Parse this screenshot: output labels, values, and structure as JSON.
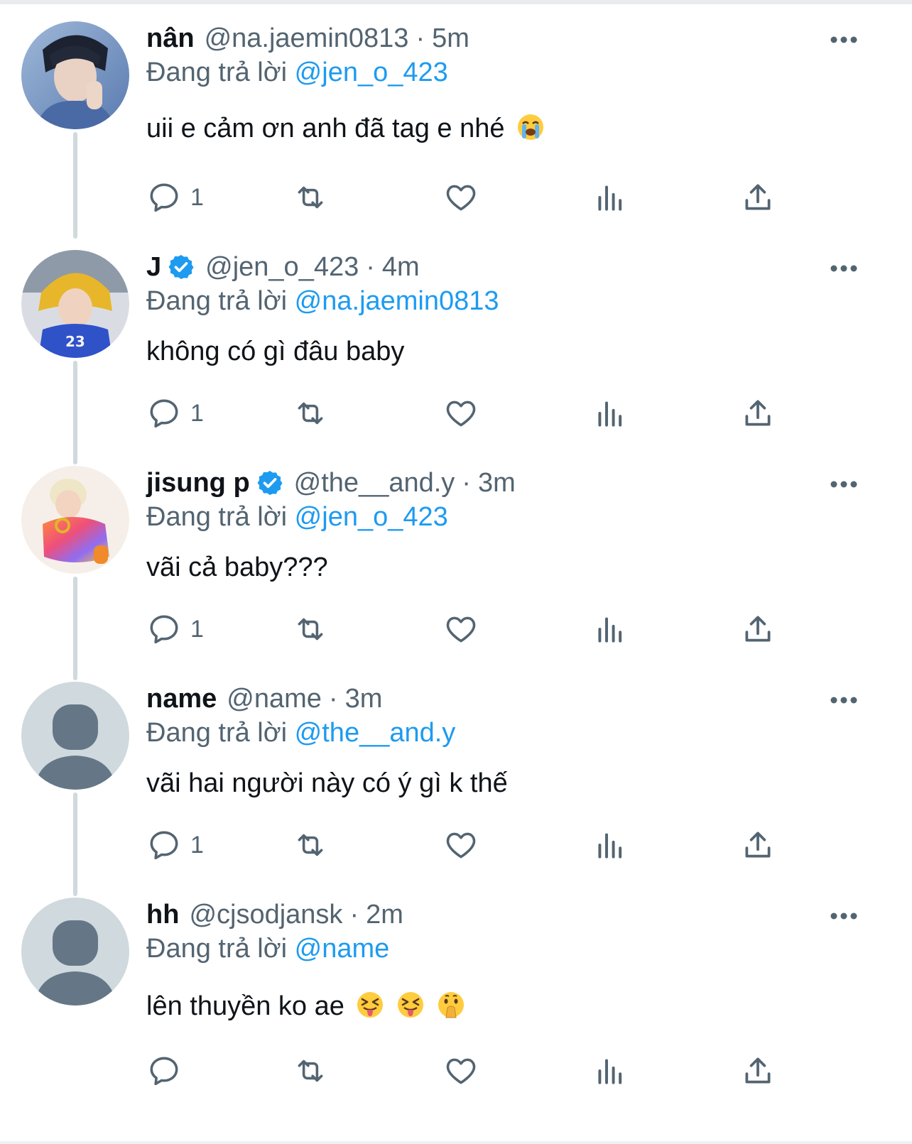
{
  "tweets": [
    {
      "display_name": "nân",
      "handle": "@na.jaemin0813",
      "time": "5m",
      "verified": false,
      "reply_prefix": "Đang trả lời",
      "reply_to": "@jen_o_423",
      "text": "uii e cảm ơn anh đã tag e nhé",
      "emojis": [
        "loudly-crying-face"
      ],
      "reply_count": "1"
    },
    {
      "display_name": "J",
      "handle": "@jen_o_423",
      "time": "4m",
      "verified": true,
      "reply_prefix": "Đang trả lời",
      "reply_to": "@na.jaemin0813",
      "text": "không có gì đâu baby",
      "emojis": [],
      "reply_count": "1"
    },
    {
      "display_name": "jisung p",
      "handle": "@the__and.y",
      "time": "3m",
      "verified": true,
      "reply_prefix": "Đang trả lời",
      "reply_to": "@jen_o_423",
      "text": "vãi cả baby???",
      "emojis": [],
      "reply_count": "1"
    },
    {
      "display_name": "name",
      "handle": "@name",
      "time": "3m",
      "verified": false,
      "reply_prefix": "Đang trả lời",
      "reply_to": "@the__and.y",
      "text": "vãi hai người này có ý gì k thế",
      "emojis": [],
      "reply_count": "1"
    },
    {
      "display_name": "hh",
      "handle": "@cjsodjansk",
      "time": "2m",
      "verified": false,
      "reply_prefix": "Đang trả lời",
      "reply_to": "@name",
      "text": "lên thuyền ko ae",
      "emojis": [
        "squinting-face-with-tongue",
        "squinting-face-with-tongue",
        "face-with-hand-over-mouth"
      ],
      "reply_count": ""
    }
  ],
  "separator": "·",
  "icons": {
    "reply": "reply-icon",
    "retweet": "retweet-icon",
    "like": "like-icon",
    "views": "views-icon",
    "share": "share-icon",
    "more": "more-icon",
    "verified": "verified-badge-icon"
  },
  "colors": {
    "link": "#1d9bf0",
    "secondary_text": "#536471",
    "primary_text": "#0f1419",
    "thread_line": "#cfd9de",
    "verified": "#1d9bf0",
    "default_avatar_bg": "#cfd9de",
    "default_avatar_fg": "#657786"
  }
}
